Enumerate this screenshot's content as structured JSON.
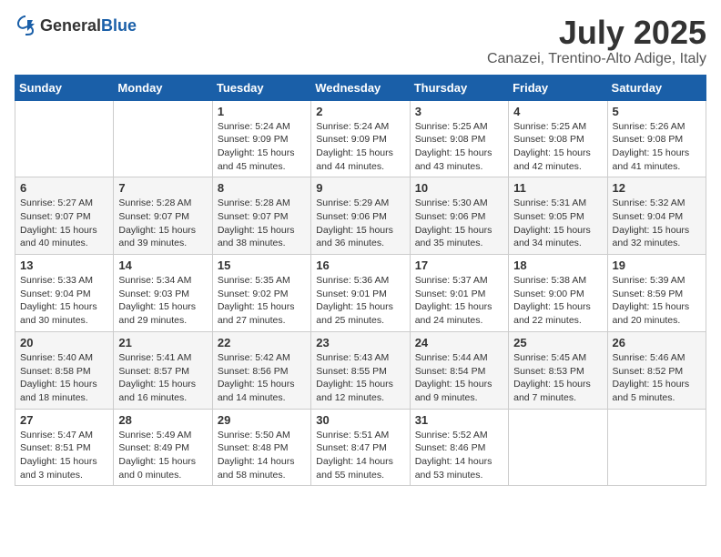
{
  "logo": {
    "general": "General",
    "blue": "Blue"
  },
  "header": {
    "month": "July 2025",
    "location": "Canazei, Trentino-Alto Adige, Italy"
  },
  "weekdays": [
    "Sunday",
    "Monday",
    "Tuesday",
    "Wednesday",
    "Thursday",
    "Friday",
    "Saturday"
  ],
  "weeks": [
    [
      {
        "day": "",
        "info": ""
      },
      {
        "day": "",
        "info": ""
      },
      {
        "day": "1",
        "info": "Sunrise: 5:24 AM\nSunset: 9:09 PM\nDaylight: 15 hours and 45 minutes."
      },
      {
        "day": "2",
        "info": "Sunrise: 5:24 AM\nSunset: 9:09 PM\nDaylight: 15 hours and 44 minutes."
      },
      {
        "day": "3",
        "info": "Sunrise: 5:25 AM\nSunset: 9:08 PM\nDaylight: 15 hours and 43 minutes."
      },
      {
        "day": "4",
        "info": "Sunrise: 5:25 AM\nSunset: 9:08 PM\nDaylight: 15 hours and 42 minutes."
      },
      {
        "day": "5",
        "info": "Sunrise: 5:26 AM\nSunset: 9:08 PM\nDaylight: 15 hours and 41 minutes."
      }
    ],
    [
      {
        "day": "6",
        "info": "Sunrise: 5:27 AM\nSunset: 9:07 PM\nDaylight: 15 hours and 40 minutes."
      },
      {
        "day": "7",
        "info": "Sunrise: 5:28 AM\nSunset: 9:07 PM\nDaylight: 15 hours and 39 minutes."
      },
      {
        "day": "8",
        "info": "Sunrise: 5:28 AM\nSunset: 9:07 PM\nDaylight: 15 hours and 38 minutes."
      },
      {
        "day": "9",
        "info": "Sunrise: 5:29 AM\nSunset: 9:06 PM\nDaylight: 15 hours and 36 minutes."
      },
      {
        "day": "10",
        "info": "Sunrise: 5:30 AM\nSunset: 9:06 PM\nDaylight: 15 hours and 35 minutes."
      },
      {
        "day": "11",
        "info": "Sunrise: 5:31 AM\nSunset: 9:05 PM\nDaylight: 15 hours and 34 minutes."
      },
      {
        "day": "12",
        "info": "Sunrise: 5:32 AM\nSunset: 9:04 PM\nDaylight: 15 hours and 32 minutes."
      }
    ],
    [
      {
        "day": "13",
        "info": "Sunrise: 5:33 AM\nSunset: 9:04 PM\nDaylight: 15 hours and 30 minutes."
      },
      {
        "day": "14",
        "info": "Sunrise: 5:34 AM\nSunset: 9:03 PM\nDaylight: 15 hours and 29 minutes."
      },
      {
        "day": "15",
        "info": "Sunrise: 5:35 AM\nSunset: 9:02 PM\nDaylight: 15 hours and 27 minutes."
      },
      {
        "day": "16",
        "info": "Sunrise: 5:36 AM\nSunset: 9:01 PM\nDaylight: 15 hours and 25 minutes."
      },
      {
        "day": "17",
        "info": "Sunrise: 5:37 AM\nSunset: 9:01 PM\nDaylight: 15 hours and 24 minutes."
      },
      {
        "day": "18",
        "info": "Sunrise: 5:38 AM\nSunset: 9:00 PM\nDaylight: 15 hours and 22 minutes."
      },
      {
        "day": "19",
        "info": "Sunrise: 5:39 AM\nSunset: 8:59 PM\nDaylight: 15 hours and 20 minutes."
      }
    ],
    [
      {
        "day": "20",
        "info": "Sunrise: 5:40 AM\nSunset: 8:58 PM\nDaylight: 15 hours and 18 minutes."
      },
      {
        "day": "21",
        "info": "Sunrise: 5:41 AM\nSunset: 8:57 PM\nDaylight: 15 hours and 16 minutes."
      },
      {
        "day": "22",
        "info": "Sunrise: 5:42 AM\nSunset: 8:56 PM\nDaylight: 15 hours and 14 minutes."
      },
      {
        "day": "23",
        "info": "Sunrise: 5:43 AM\nSunset: 8:55 PM\nDaylight: 15 hours and 12 minutes."
      },
      {
        "day": "24",
        "info": "Sunrise: 5:44 AM\nSunset: 8:54 PM\nDaylight: 15 hours and 9 minutes."
      },
      {
        "day": "25",
        "info": "Sunrise: 5:45 AM\nSunset: 8:53 PM\nDaylight: 15 hours and 7 minutes."
      },
      {
        "day": "26",
        "info": "Sunrise: 5:46 AM\nSunset: 8:52 PM\nDaylight: 15 hours and 5 minutes."
      }
    ],
    [
      {
        "day": "27",
        "info": "Sunrise: 5:47 AM\nSunset: 8:51 PM\nDaylight: 15 hours and 3 minutes."
      },
      {
        "day": "28",
        "info": "Sunrise: 5:49 AM\nSunset: 8:49 PM\nDaylight: 15 hours and 0 minutes."
      },
      {
        "day": "29",
        "info": "Sunrise: 5:50 AM\nSunset: 8:48 PM\nDaylight: 14 hours and 58 minutes."
      },
      {
        "day": "30",
        "info": "Sunrise: 5:51 AM\nSunset: 8:47 PM\nDaylight: 14 hours and 55 minutes."
      },
      {
        "day": "31",
        "info": "Sunrise: 5:52 AM\nSunset: 8:46 PM\nDaylight: 14 hours and 53 minutes."
      },
      {
        "day": "",
        "info": ""
      },
      {
        "day": "",
        "info": ""
      }
    ]
  ]
}
